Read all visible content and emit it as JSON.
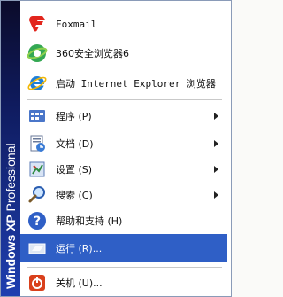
{
  "side_banner": {
    "windows": "Windows",
    "xp": "XP",
    "edition": "Professional"
  },
  "pinned": [
    {
      "label": "Foxmail",
      "icon": "foxmail-icon"
    },
    {
      "label": "360安全浏览器6",
      "icon": "360-browser-icon"
    },
    {
      "label": "启动 Internet Explorer 浏览器",
      "icon": "internet-explorer-icon"
    }
  ],
  "menu": [
    {
      "label": "程序 (P)",
      "icon": "programs-icon",
      "arrow": true
    },
    {
      "label": "文档 (D)",
      "icon": "documents-icon",
      "arrow": true
    },
    {
      "label": "设置 (S)",
      "icon": "settings-icon",
      "arrow": true
    },
    {
      "label": "搜索 (C)",
      "icon": "search-icon",
      "arrow": true
    },
    {
      "label": "帮助和支持 (H)",
      "icon": "help-icon",
      "arrow": false
    },
    {
      "label": "运行 (R)...",
      "icon": "run-icon",
      "arrow": false,
      "selected": true
    }
  ],
  "shutdown": {
    "label": "关机 (U)...",
    "icon": "shutdown-icon"
  },
  "colors": {
    "selection": "#2f5fc6",
    "strip_top": "#0b0b2a",
    "strip_bottom": "#1e3fb0"
  }
}
